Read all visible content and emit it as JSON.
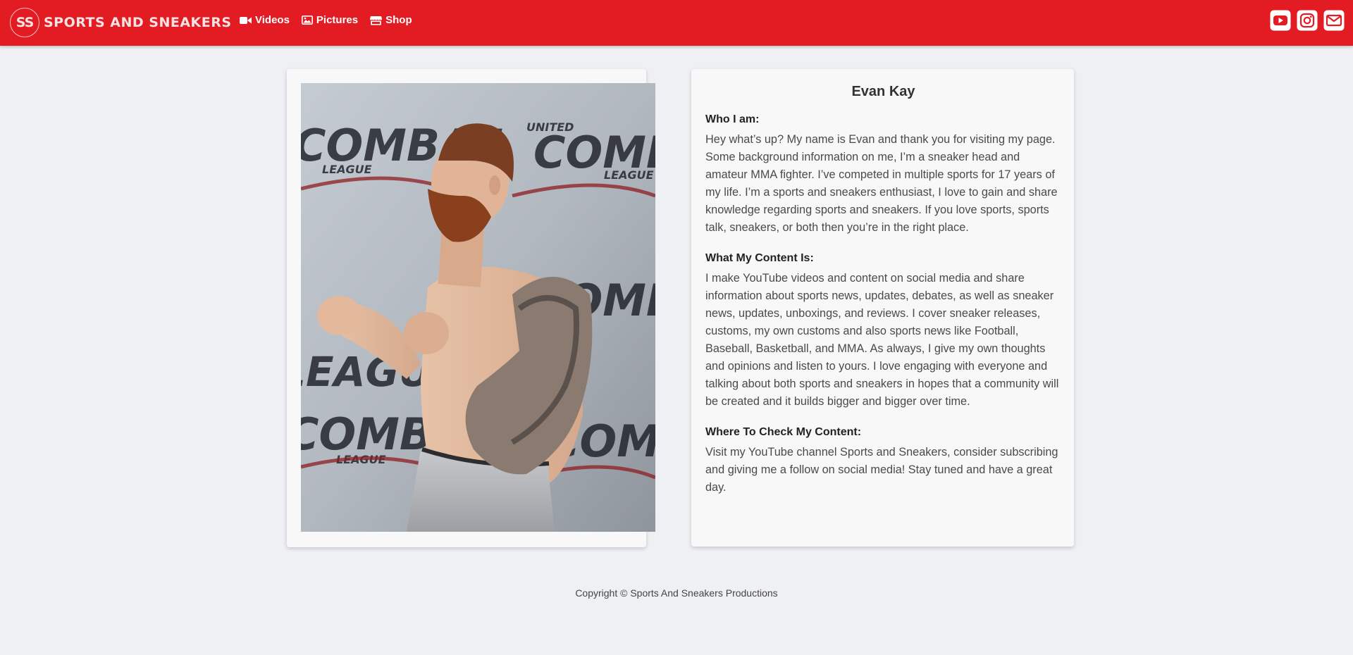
{
  "brand": {
    "logo_text": "SS",
    "name": "SPORTS AND SNEAKERS"
  },
  "nav": {
    "items": [
      {
        "label": "Videos",
        "icon": "video-camera-icon"
      },
      {
        "label": "Pictures",
        "icon": "image-icon"
      },
      {
        "label": "Shop",
        "icon": "store-icon"
      }
    ]
  },
  "social": [
    {
      "name": "YouTube",
      "icon": "youtube-icon"
    },
    {
      "name": "Instagram",
      "icon": "instagram-icon"
    },
    {
      "name": "Email",
      "icon": "envelope-icon"
    }
  ],
  "colors": {
    "navbar": "#e31b23",
    "background": "#eff0f4",
    "card": "#f8f8f8"
  },
  "photo": {
    "backdrop_words": [
      "COMBAT",
      "LEAGUE",
      "UNITED"
    ]
  },
  "bio": {
    "name": "Evan Kay",
    "sections": [
      {
        "heading": "Who I am:",
        "text": "Hey what’s up? My name is Evan and thank you for visiting my page. Some background information on me, I’m a sneaker head and amateur MMA fighter. I’ve competed in multiple sports for 17 years of my life. I’m a sports and sneakers enthusiast, I love to gain and share knowledge regarding sports and sneakers. If you love sports, sports talk, sneakers, or both then you’re in the right place."
      },
      {
        "heading": "What My Content Is:",
        "text": "I make YouTube videos and content on social media and share information about sports news, updates, debates, as well as sneaker news, updates, unboxings, and reviews. I cover sneaker releases, customs, my own customs and also sports news like Football, Baseball, Basketball, and MMA. As always, I give my own thoughts and opinions and listen to yours. I love engaging with everyone and talking about both sports and sneakers in hopes that a community will be created and it builds bigger and bigger over time."
      },
      {
        "heading": "Where To Check My Content:",
        "text": "Visit my YouTube channel Sports and Sneakers, consider subscribing and giving me a follow on social media! Stay tuned and have a great day."
      }
    ]
  },
  "footer": {
    "copyright": "Copyright © Sports And Sneakers Productions"
  }
}
